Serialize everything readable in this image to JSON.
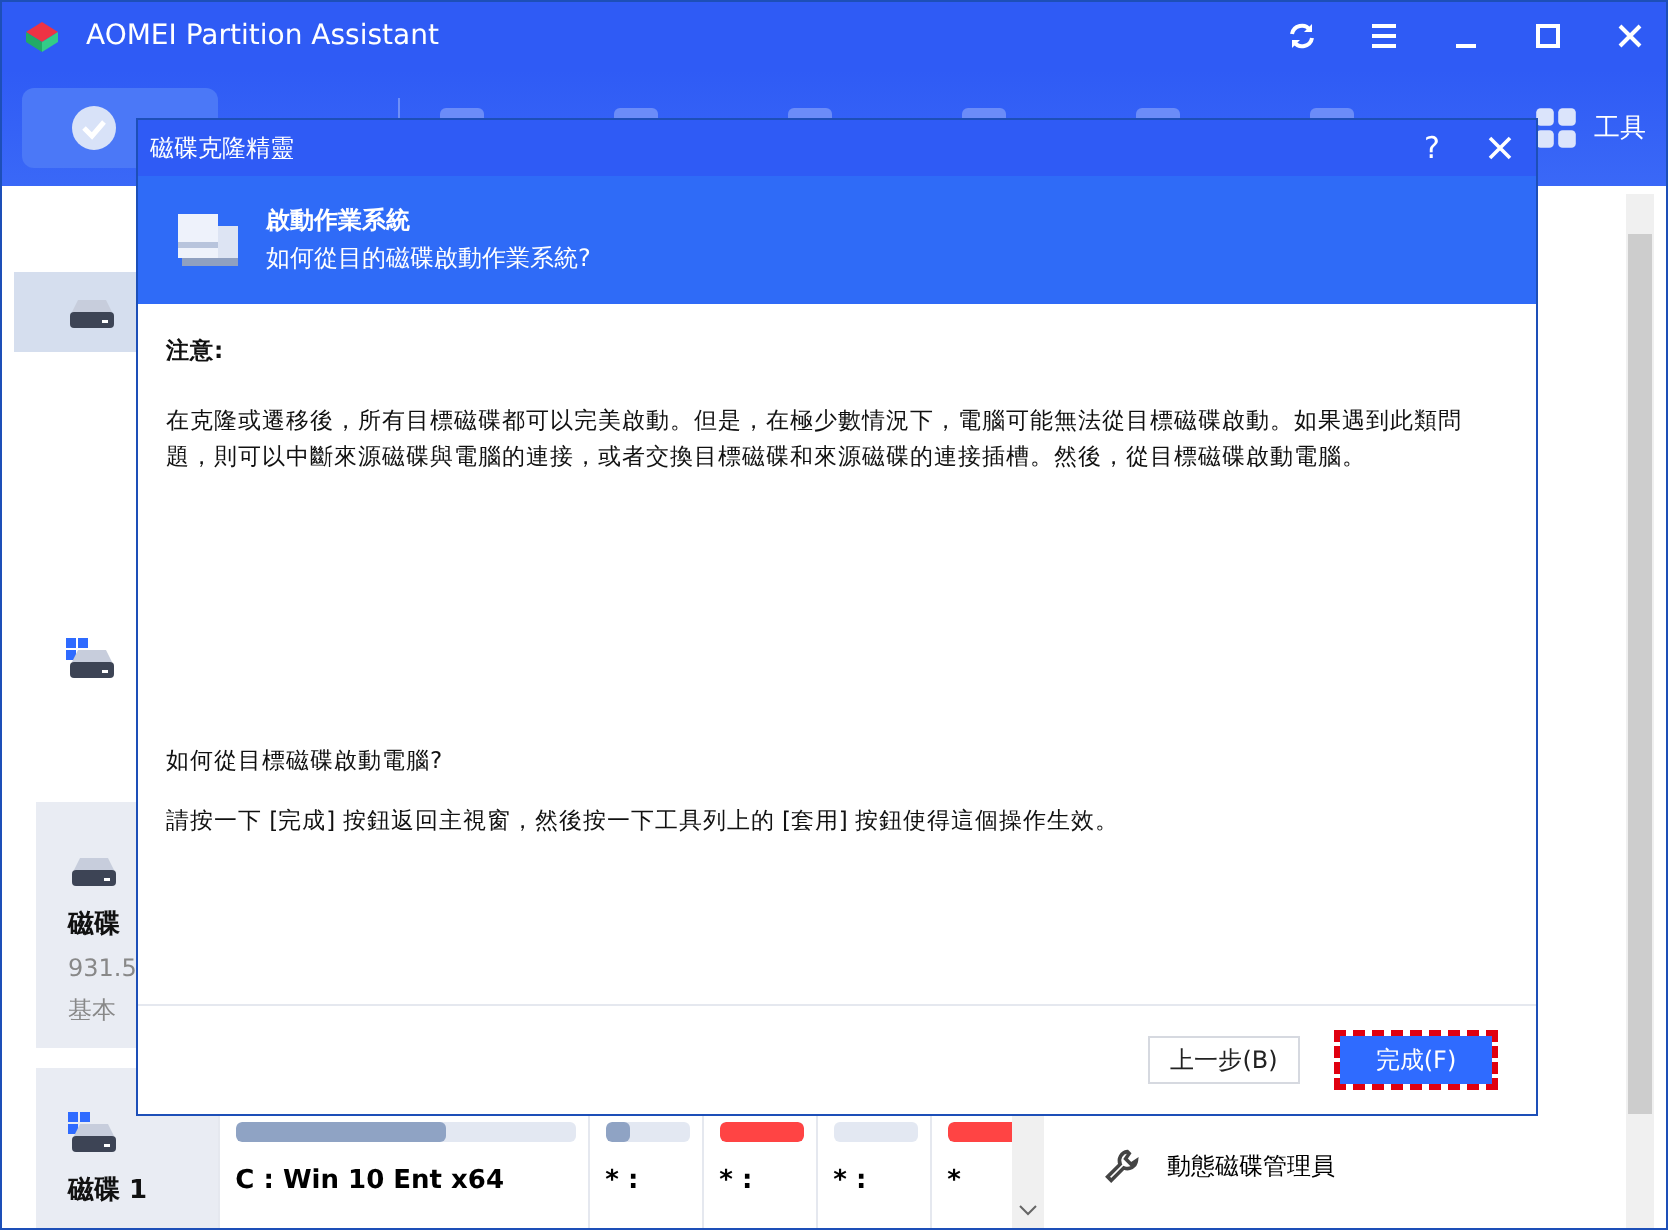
{
  "app": {
    "title": "AOMEI Partition Assistant",
    "tools_label": "工具"
  },
  "sidebar": {
    "items": [
      {
        "selected": true,
        "kind": "disk"
      },
      {
        "selected": false,
        "kind": "system"
      }
    ]
  },
  "disk_cards": [
    {
      "kind": "disk",
      "name": "磁碟",
      "size": "931.5",
      "type": "基本"
    },
    {
      "kind": "system",
      "name": "磁碟 1"
    }
  ],
  "partitions": [
    {
      "label": "C : Win 10 Ent x64",
      "level": 0.62,
      "color": "#8fa3c4"
    },
    {
      "label": "* :",
      "level": 0.3,
      "color": "#8fa3c4"
    },
    {
      "label": "* :",
      "level": 1,
      "color": "#ff4444"
    },
    {
      "label": "* :"
    },
    {
      "label": "*",
      "level": 1,
      "color": "#ff4444"
    }
  ],
  "side_actions": [
    {
      "label": "動態磁碟管理員"
    }
  ],
  "dialog": {
    "title": "磁碟克隆精靈",
    "help_label": "?",
    "heading": "啟動作業系統",
    "subheading": "如何從目的磁碟啟動作業系統?",
    "note_title": "注意:",
    "note": "在克隆或遷移後，所有目標磁碟都可以完美啟動。但是，在極少數情況下，電腦可能無法從目標磁碟啟動。如果遇到此類問題，則可以中斷來源磁碟與電腦的連接，或者交換目標磁碟和來源磁碟的連接插槽。然後，從目標磁碟啟動電腦。",
    "question": "如何從目標磁碟啟動電腦?",
    "instruction": "請按一下 [完成] 按鈕返回主視窗，然後按一下工具列上的 [套用] 按鈕使得這個操作生效。",
    "buttons": [
      {
        "label": "上一步(B)",
        "kind": "secondary",
        "highlighted": false
      },
      {
        "label": "完成(F)",
        "kind": "primary",
        "highlighted": true
      }
    ]
  }
}
